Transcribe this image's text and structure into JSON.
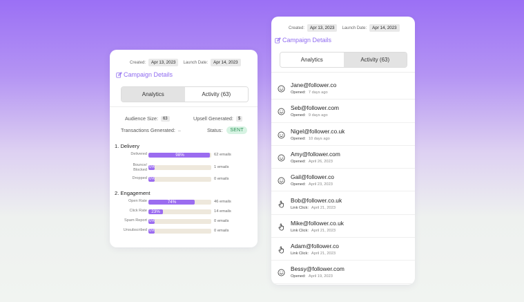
{
  "left_card": {
    "created_label": "Created:",
    "created_value": "Apr 13, 2023",
    "launch_label": "Launch Date:",
    "launch_value": "Apr 14, 2023",
    "campaign_details": "Campaign Details",
    "tabs": [
      {
        "label": "Analytics",
        "active": true
      },
      {
        "label": "Activity (63)",
        "active": false
      }
    ],
    "audience_size_label": "Audience Size:",
    "audience_size_value": "63",
    "upsell_label": "Upsell Generated:",
    "upsell_value": "$",
    "transactions_label": "Transactions Generated:",
    "transactions_value": "–",
    "status_label": "Status:",
    "status_value": "SENT",
    "delivery_title": "1. Delivery",
    "delivery": [
      {
        "label": "Delivered",
        "pct": "98%",
        "fraction": 0.98,
        "count": "62 emails"
      },
      {
        "label": "Bounce/ Blocked",
        "label_line1": "Bounce/",
        "label_line2": "Blocked",
        "pct": "0%",
        "fraction": 0,
        "count": "1 emails"
      },
      {
        "label": "Dropped",
        "pct": "0%",
        "fraction": 0,
        "count": "0 emails"
      }
    ],
    "engagement_title": "2. Engagement",
    "engagement": [
      {
        "label": "Open Rate",
        "pct": "74%",
        "fraction": 0.74,
        "count": "46 emails"
      },
      {
        "label": "Click Rate",
        "pct": "23%",
        "fraction": 0.23,
        "count": "14 emails"
      },
      {
        "label": "Spam Report",
        "pct": "0%",
        "fraction": 0,
        "count": "0 emails"
      },
      {
        "label": "Unsubscribed",
        "pct": "0%",
        "fraction": 0,
        "count": "0 emails"
      }
    ]
  },
  "right_card": {
    "created_label": "Created:",
    "created_value": "Apr 13, 2023",
    "launch_label": "Launch Date:",
    "launch_value": "Apr 14, 2023",
    "campaign_details": "Campaign Details",
    "tabs": [
      {
        "label": "Analytics",
        "active": false
      },
      {
        "label": "Activity (63)",
        "active": true
      }
    ],
    "activity": [
      {
        "email": "Jane@follower.co",
        "action": "Opened:",
        "when": "7 days ago",
        "icon": "smile-icon"
      },
      {
        "email": "Seb@follower.com",
        "action": "Opened:",
        "when": "9 days ago",
        "icon": "smile-icon"
      },
      {
        "email": "Nigel@follower.co.uk",
        "action": "Opened:",
        "when": "10 days ago",
        "icon": "smile-icon"
      },
      {
        "email": "Amy@follower.com",
        "action": "Opened:",
        "when": "April 26, 2023",
        "icon": "smile-icon"
      },
      {
        "email": "Gail@follower.co",
        "action": "Opened:",
        "when": "April 23, 2023",
        "icon": "smile-icon"
      },
      {
        "email": "Bob@follower.co.uk",
        "action": "Link Click:",
        "when": "April 21, 2023",
        "icon": "pointer-icon"
      },
      {
        "email": "Mike@follower.co.uk",
        "action": "Link Click:",
        "when": "April 21, 2023",
        "icon": "pointer-icon"
      },
      {
        "email": "Adam@follower.co",
        "action": "Link Click:",
        "when": "April 21, 2023",
        "icon": "pointer-icon"
      },
      {
        "email": "Bessy@follower.com",
        "action": "Opened:",
        "when": "April 19, 2023",
        "icon": "smile-icon"
      }
    ]
  },
  "colors": {
    "accent": "#9b6cf0",
    "sent_bg": "#d7f3e3",
    "sent_text": "#2c9257",
    "track": "#eee8dc"
  }
}
